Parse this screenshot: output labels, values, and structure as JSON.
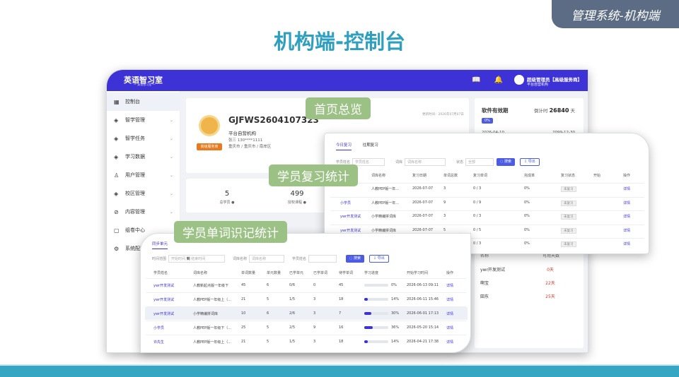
{
  "slide": {
    "tag": "管理系统-机构端",
    "title": "机构端-控制台"
  },
  "callouts": {
    "overview": "首页总览",
    "review": "学员复习统计",
    "words": "学员单词识记统计"
  },
  "app": {
    "logo": "英语智习室",
    "logo_sub": "— 英语智习室 —",
    "icons": "📖 🔔 ⊡",
    "user_name": "超级管理员【高级服务商】",
    "user_org": "平台自营机构"
  },
  "sidebar": [
    {
      "label": "控制台",
      "icon": "▦",
      "active": true
    },
    {
      "label": "智学管理",
      "icon": "◈"
    },
    {
      "label": "智学任务",
      "icon": "◈"
    },
    {
      "label": "学习数据",
      "icon": "◈"
    },
    {
      "label": "用户管理",
      "icon": "♙"
    },
    {
      "label": "校区管理",
      "icon": "◈"
    },
    {
      "label": "内容管理",
      "icon": "⊘"
    },
    {
      "label": "组卷中心",
      "icon": "▢"
    },
    {
      "label": "系统配置",
      "icon": "⚙"
    }
  ],
  "org": {
    "code": "GJFWS2604107323",
    "name": "平台自营机构",
    "phone": "张三 130****1111",
    "address": "重庆市 / 重庆市 / 南岸区",
    "level": "高级服务商",
    "update_time": "更新时间：2026年07月07日"
  },
  "stats": [
    {
      "value": "5",
      "label": "总学员 ●"
    },
    {
      "value": "499",
      "label": "授权课程 ●"
    }
  ],
  "license": {
    "title": "软件有效期",
    "count_prefix": "倒计时",
    "count": "26840",
    "unit": "天",
    "pct": "0%",
    "start": "2026-04-10",
    "end": "2099-12-30"
  },
  "ranking": {
    "headers": [
      "名称",
      "可用天数"
    ],
    "rows": [
      {
        "name": "ywr开发测试",
        "days": "0天"
      },
      {
        "name": "啊宝",
        "days": "22天"
      },
      {
        "name": "田东",
        "days": "25天"
      }
    ]
  },
  "review": {
    "tabs": [
      "今日复习",
      "往期复习"
    ],
    "filters": {
      "name_label": "学员姓名",
      "name_ph": "学员姓名",
      "course_label": "词库",
      "course_ph": "词库名称",
      "status_label": "状态",
      "status_value": "全部",
      "search": "◌ 搜索",
      "export": "⇩ 导出"
    },
    "headers": [
      "",
      "词库名称",
      "复习日期",
      "单词总数",
      "复习单词",
      "完成率",
      "复习状态",
      "开始",
      "操作"
    ],
    "rows": [
      {
        "student": "",
        "course": "人教PEP版一年...",
        "date": "2026-07-07",
        "total": "3",
        "words": "0 / 3",
        "rate": "0%",
        "status": "未复习",
        "op": "详情"
      },
      {
        "student": "小学员",
        "course": "人教PEP版一年...",
        "date": "2026-07-07",
        "total": "9",
        "words": "0 / 9",
        "rate": "0%",
        "status": "未复习",
        "op": "详情"
      },
      {
        "student": "ywr开发测试",
        "course": "小学精编拼词库",
        "date": "2026-07-07",
        "total": "3",
        "words": "0 / 3",
        "rate": "0%",
        "status": "未复习",
        "op": "详情"
      },
      {
        "student": "ywr开发测试",
        "course": "小学精编拼词库",
        "date": "2026-07-07",
        "total": "5",
        "words": "0 / 5",
        "rate": "0%",
        "status": "未复习",
        "op": "详情"
      },
      {
        "student": "ywr开发测试",
        "course": "人教PEP版一年...",
        "date": "2026-07-07",
        "total": "3",
        "words": "0 / 3",
        "rate": "0%",
        "status": "未复习",
        "op": "详情"
      }
    ]
  },
  "words": {
    "tab": "同步单元",
    "filters": {
      "time_label": "时间范围",
      "start_ph": "开始时间",
      "to": "到",
      "end_ph": "结束时间",
      "course_label": "词库名称",
      "course_ph": "词库名称",
      "student_label": "学员姓名",
      "search": "◌ 搜索",
      "export": "⇩ 导出"
    },
    "headers": [
      "学员姓名",
      "词库名称",
      "单词数量",
      "单元数量",
      "已学单元",
      "已学单词",
      "待学单词",
      "学习进度",
      "开始学习时间",
      "操作"
    ],
    "rows": [
      {
        "student": "ywr开发测试",
        "course": "人教新起点版一年级下",
        "words": "45",
        "units": "6",
        "learned_units": "0/6",
        "learned_words": "0",
        "todo": "45",
        "progress": 0,
        "progress_text": "0%",
        "start": "2026-06-13 09:11",
        "op": "详情"
      },
      {
        "student": "ywr开发测试",
        "course": "人教PEP版一年级上（...",
        "words": "21",
        "units": "5",
        "learned_units": "1/5",
        "learned_words": "3",
        "todo": "18",
        "progress": 14,
        "progress_text": "14%",
        "start": "2026-06-11 15:46",
        "op": "详情"
      },
      {
        "student": "ywr开发测试",
        "course": "小学精编拼词库",
        "words": "10",
        "units": "6",
        "learned_units": "2/6",
        "learned_words": "3",
        "todo": "7",
        "progress": 30,
        "progress_text": "30%",
        "start": "2026-06-01 17:13",
        "op": "详情"
      },
      {
        "student": "小学员",
        "course": "人教PEP版一年级下（...",
        "words": "25",
        "units": "5",
        "learned_units": "2/5",
        "learned_words": "9",
        "todo": "16",
        "progress": 36,
        "progress_text": "36%",
        "start": "2026-05-20 15:14",
        "op": "详情"
      },
      {
        "student": "许先生",
        "course": "人教PEP版一年级上（...",
        "words": "21",
        "units": "5",
        "learned_units": "1/5",
        "learned_words": "3",
        "todo": "18",
        "progress": 14,
        "progress_text": "14%",
        "start": "2026-04-21 17:38",
        "op": "详情"
      }
    ]
  }
}
